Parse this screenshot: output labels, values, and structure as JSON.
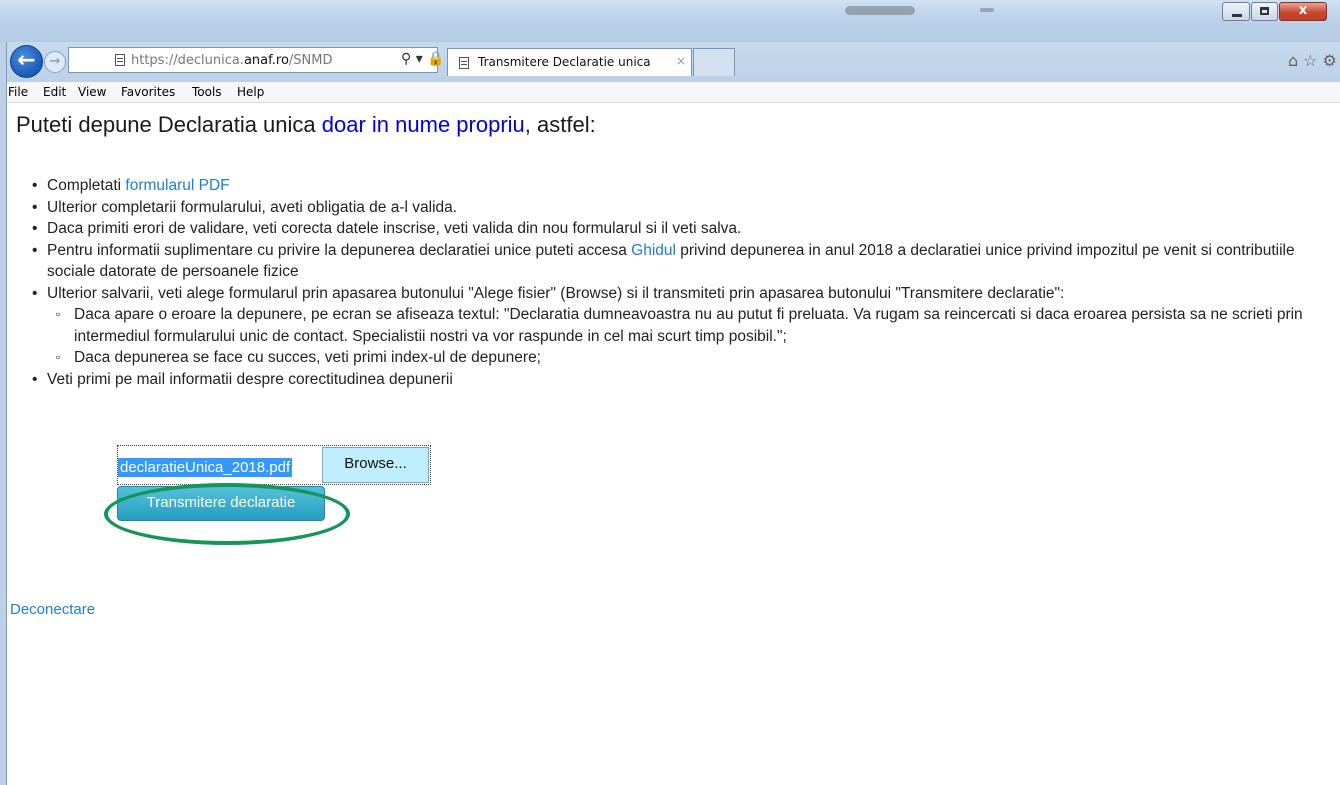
{
  "browser": {
    "address_url_prefix": "https://declunica.",
    "address_url_domain": "anaf.ro",
    "address_url_suffix": "/SNMD",
    "address_icons": "⚲ ▾ 🔒 ↻",
    "tab_title": "Transmitere Declaratie unica",
    "tab_close": "×",
    "window_controls": {
      "minimize": "–",
      "maximize": "□",
      "close": "x"
    },
    "toolbar_icons": {
      "home": "⌂",
      "favorites": "☆",
      "settings": "⚙"
    }
  },
  "menu": [
    "File",
    "Edit",
    "View",
    "Favorites",
    "Tools",
    "Help"
  ],
  "heading": {
    "part1": "Puteti depune Declaratia unica ",
    "highlight": "doar in nume propriu",
    "part2": ", astfel:"
  },
  "bullets": {
    "b1_text": "Completati ",
    "b1_link": "formularul PDF",
    "b2": "Ulterior completarii formularului, aveti obligatia de a-l valida.",
    "b3": "Daca primiti erori de validare, veti corecta datele inscrise, veti valida din nou formularul si il veti salva.",
    "b4_text1": "Pentru informatii suplimentare cu privire la depunerea declaratiei unice puteti accesa ",
    "b4_link": "Ghidul",
    "b4_text2": " privind depunerea in anul 2018 a declaratiei unice privind impozitul pe venit si contributiile sociale datorate de persoanele fizice",
    "b5": "Ulterior salvarii, veti alege formularul prin apasarea butonului \"Alege fisier\" (Browse) si il transmiteti prin apasarea butonului \"Transmitere declaratie\":",
    "sub1": "Daca apare o eroare la depunere, pe ecran se afiseaza textul: \"Declaratia dumneavoastra nu au putut fi preluata. Va rugam sa reincercati si daca eroarea persista sa ne scrieti prin intermediul formularului unic de contact. Specialistii nostri va vor raspunde in cel mai scurt timp posibil.\";",
    "sub2": "Daca depunerea se face cu succes, veti primi index-ul de depunere;",
    "b6": "Veti primi pe mail informatii despre corectitudinea depunerii"
  },
  "upload": {
    "file_name": "declaratieUnica_2018.pdf",
    "browse_label": "Browse...",
    "submit_label": "Transmitere declaratie"
  },
  "logout_label": "Deconectare",
  "colors": {
    "link": "#1e7fd0",
    "heading_highlight": "#0000e0",
    "submit_button": "#279dc0",
    "highlight_ellipse": "#15955a"
  }
}
